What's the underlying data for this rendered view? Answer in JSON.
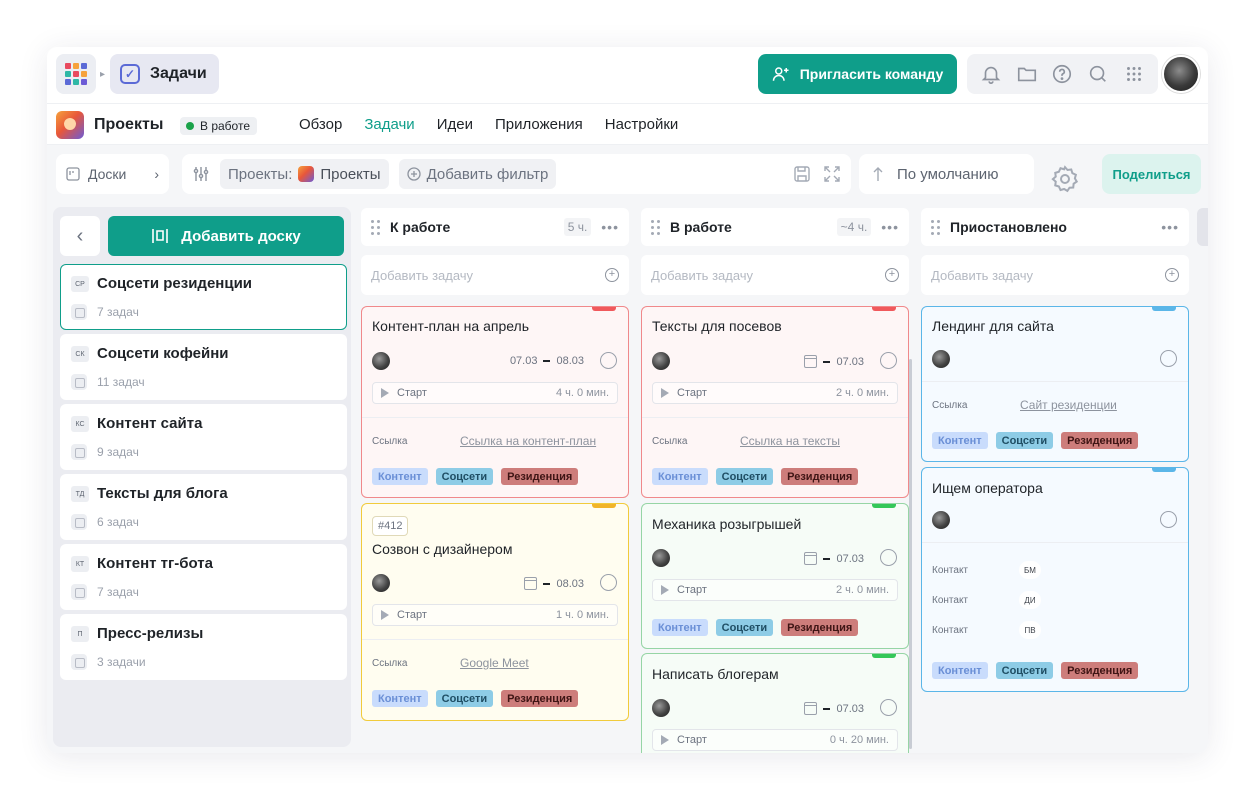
{
  "topbar": {
    "breadcrumb_title": "Задачи",
    "invite_label": "Пригласить команду",
    "apps_colors": [
      "#e84a5f",
      "#f6a23c",
      "#5b6ad6",
      "#2fb8a6",
      "#e84a5f",
      "#f6a23c",
      "#5b6ad6",
      "#2fb8a6",
      "#6c5bd6"
    ]
  },
  "project": {
    "name": "Проекты",
    "status": "В работе",
    "status_color": "#1ba24a",
    "nav": [
      {
        "label": "Обзор",
        "active": false
      },
      {
        "label": "Задачи",
        "active": true
      },
      {
        "label": "Идеи",
        "active": false
      },
      {
        "label": "Приложения",
        "active": false
      },
      {
        "label": "Настройки",
        "active": false
      }
    ]
  },
  "filterbar": {
    "boards_label": "Доски",
    "filter_key": "Проекты:",
    "filter_value": "Проекты",
    "add_filter_label": "Добавить фильтр",
    "sort_label": "По умолчанию",
    "share_label": "Поделиться"
  },
  "sidebar": {
    "add_board_label": "Добавить доску",
    "boards": [
      {
        "abbr": "СР",
        "name": "Соцсети резиденции",
        "count": "7 задач",
        "selected": true
      },
      {
        "abbr": "СК",
        "name": "Соцсети кофейни",
        "count": "11 задач",
        "selected": false
      },
      {
        "abbr": "КС",
        "name": "Контент сайта",
        "count": "9 задач",
        "selected": false
      },
      {
        "abbr": "ТД",
        "name": "Тексты для блога",
        "count": "6 задач",
        "selected": false
      },
      {
        "abbr": "КТ",
        "name": "Контент тг-бота",
        "count": "7 задач",
        "selected": false
      },
      {
        "abbr": "П",
        "name": "Пресс-релизы",
        "count": "3 задачи",
        "selected": false
      }
    ]
  },
  "columns": {
    "add_task_placeholder": "Добавить задачу",
    "todo": {
      "title": "К работе",
      "time": "5 ч."
    },
    "inprogress": {
      "title": "В работе",
      "time": "~4 ч."
    },
    "paused": {
      "title": "Приостановлено"
    }
  },
  "cards": {
    "c1": {
      "title": "Контент-план на апрель",
      "start": "07.03",
      "end": "08.03",
      "timer_label": "Старт",
      "duration": "4 ч. 0 мин.",
      "field_label": "Ссылка",
      "field_value": "Ссылка на контент-план"
    },
    "c2": {
      "number": "#412",
      "title": "Созвон с дизайнером",
      "end": "08.03",
      "timer_label": "Старт",
      "duration": "1 ч. 0 мин.",
      "field_label": "Ссылка",
      "field_value": "Google Meet"
    },
    "c3": {
      "title": "Тексты для посевов",
      "end": "07.03",
      "timer_label": "Старт",
      "duration": "2 ч. 0 мин.",
      "field_label": "Ссылка",
      "field_value": "Ссылка на тексты"
    },
    "c4": {
      "title": "Механика розыгрышей",
      "end": "07.03",
      "timer_label": "Старт",
      "duration": "2 ч. 0 мин."
    },
    "c5": {
      "title": "Написать блогерам",
      "end": "07.03",
      "timer_label": "Старт",
      "duration": "0 ч. 20 мин."
    },
    "c6": {
      "title": "Лендинг для сайта",
      "field_label": "Ссылка",
      "field_value": "Сайт резиденции"
    },
    "c7": {
      "title": "Ищем оператора",
      "contact_label": "Контакт",
      "contacts": [
        "БМ",
        "ДИ",
        "ПВ"
      ]
    }
  },
  "tags": [
    "Контент",
    "Соцсети",
    "Резиденция"
  ],
  "colors": {
    "accent": "#0f9e8a",
    "red": "#f0898b",
    "yellow": "#f1cb3c",
    "green": "#96d5a5",
    "blue": "#5bb6e8"
  }
}
